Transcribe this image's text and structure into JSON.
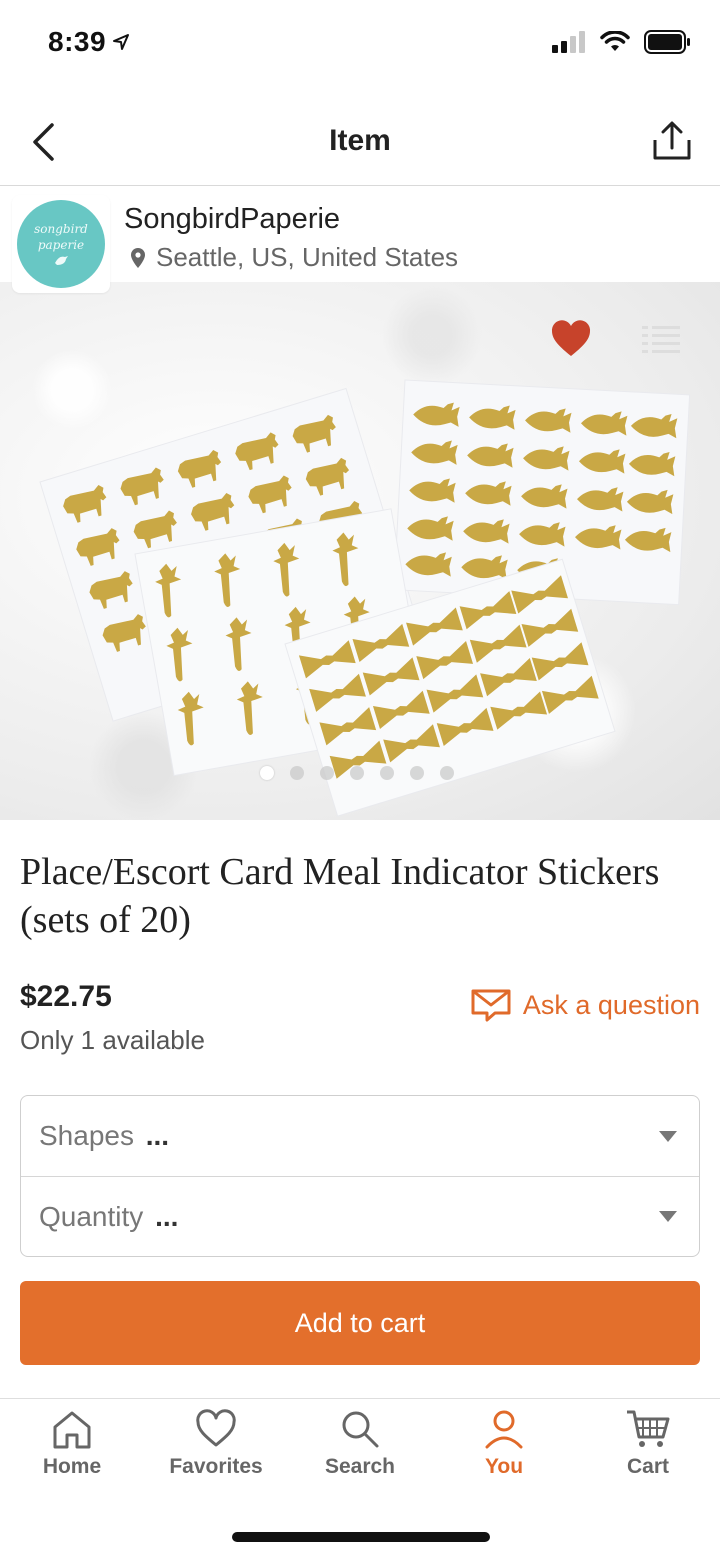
{
  "status_bar": {
    "time": "8:39"
  },
  "nav": {
    "title": "Item"
  },
  "shop": {
    "name": "SongbirdPaperie",
    "location": "Seattle, US, United States",
    "avatar_text_line1": "songbird",
    "avatar_text_line2": "paperie"
  },
  "image": {
    "favorited": true,
    "carousel": {
      "total": 7,
      "current": 1
    }
  },
  "product": {
    "title": "Place/Escort Card Meal Indicator Stickers (sets of 20)",
    "price": "$22.75",
    "availability": "Only 1 available"
  },
  "ask_question": {
    "label": "Ask a question"
  },
  "variations": [
    {
      "label": "Shapes",
      "value": "..."
    },
    {
      "label": "Quantity",
      "value": "..."
    }
  ],
  "add_to_cart": {
    "label": "Add to cart"
  },
  "tabs": [
    {
      "label": "Home",
      "icon": "home-icon"
    },
    {
      "label": "Favorites",
      "icon": "heart-icon"
    },
    {
      "label": "Search",
      "icon": "search-icon"
    },
    {
      "label": "You",
      "icon": "person-icon",
      "active": true
    },
    {
      "label": "Cart",
      "icon": "cart-icon"
    }
  ],
  "colors": {
    "accent": "#e36f2c",
    "favorite": "#c7432b",
    "avatar": "#68c7c4",
    "sticker_gold": "#c9a845"
  }
}
